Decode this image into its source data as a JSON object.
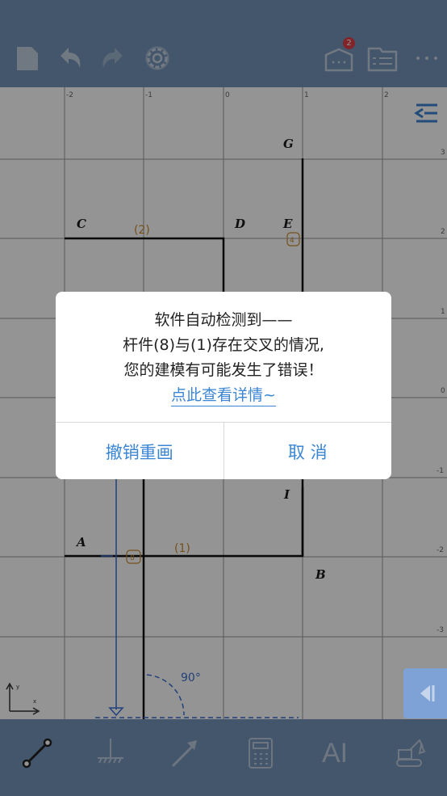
{
  "toolbar": {
    "badge_count": "2"
  },
  "canvas": {
    "x_ticks": [
      "-2",
      "-1",
      "0",
      "1",
      "2"
    ],
    "y_ticks": [
      "3",
      "2",
      "1",
      "0",
      "-1",
      "-2",
      "-3"
    ],
    "node_labels": {
      "A": "A",
      "B": "B",
      "C": "C",
      "D": "D",
      "E": "E",
      "G": "G",
      "I": "I"
    },
    "member_labels": {
      "m1": "(1)",
      "m2": "(2)",
      "m4": "4",
      "m8": "8"
    },
    "angle_label": "90°",
    "axis_labels": {
      "x": "x",
      "y": "y"
    }
  },
  "bottom_tools": {
    "ai_label": "AI"
  },
  "dialog": {
    "line1": "软件自动检测到——",
    "line2": "杆件(8)与(1)存在交叉的情况,",
    "line3": "您的建模有可能发生了错误！",
    "link": "点此查看详情~",
    "redraw_button": "撤销重画",
    "cancel_button": "取 消"
  },
  "colors": {
    "bar": "#7595b9",
    "accent": "#3b86d4",
    "member": "#c98a2f",
    "node": "#1a1a1a"
  }
}
